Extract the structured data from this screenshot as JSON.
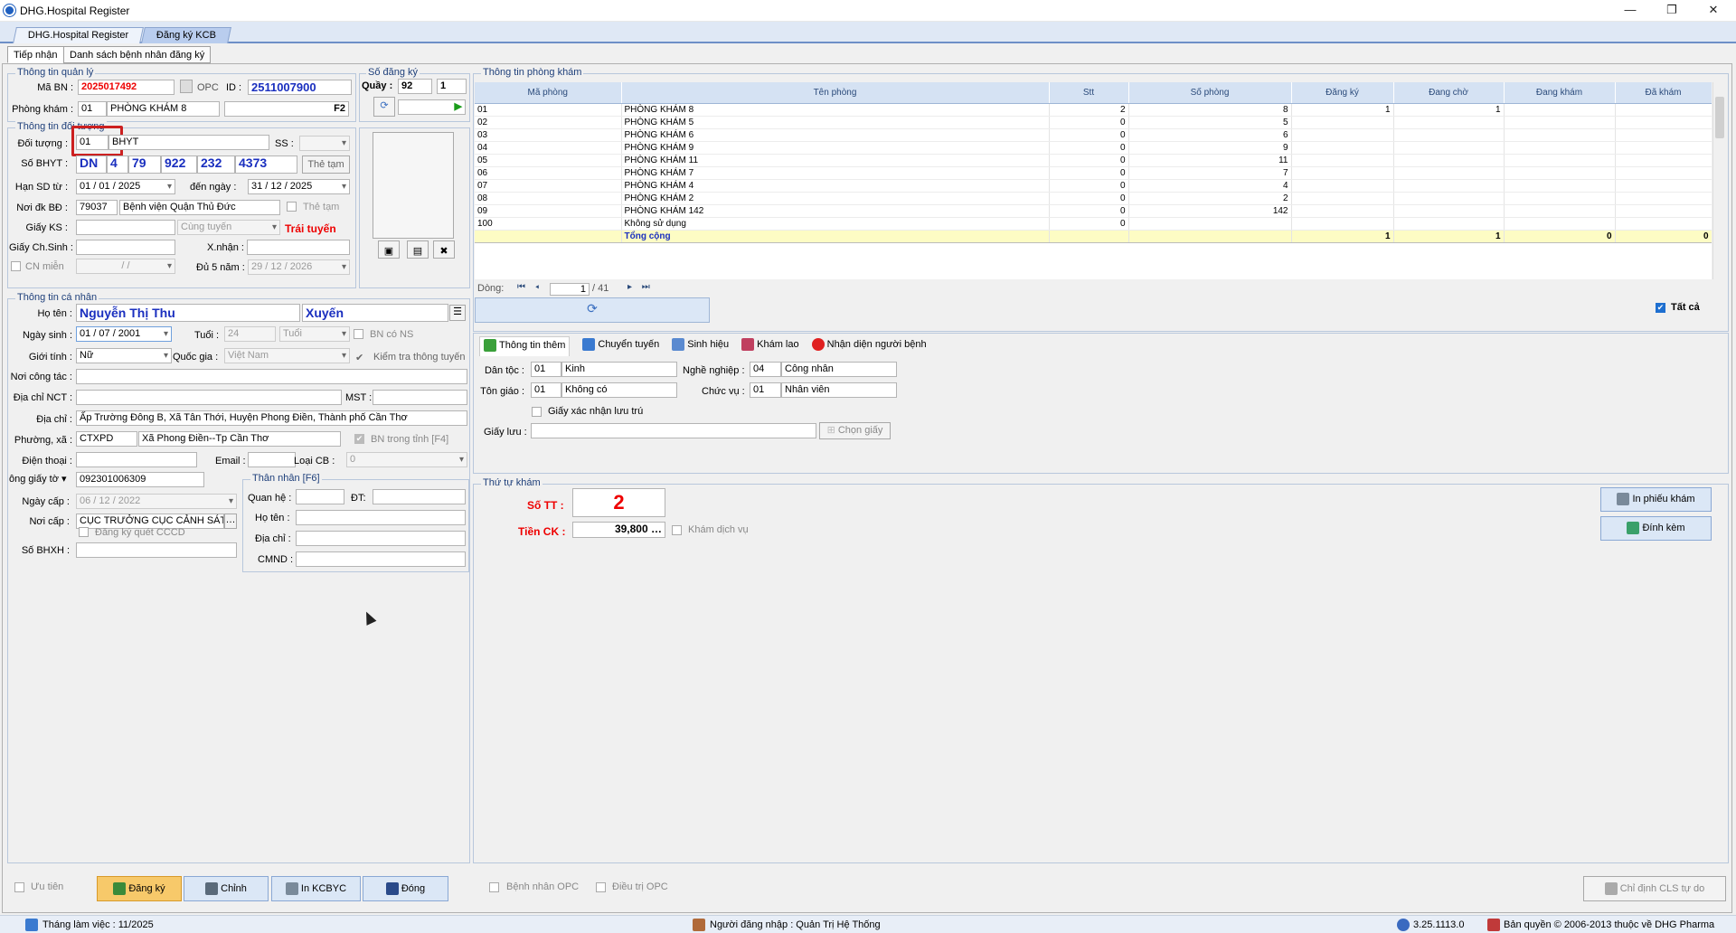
{
  "window": {
    "title": "DHG.Hospital Register",
    "minimize": "—",
    "maximize": "❐",
    "close": "✕"
  },
  "tabs": [
    "DHG.Hospital Register",
    "Đăng ký KCB"
  ],
  "subtabs": [
    "Tiếp nhận",
    "Danh sách bệnh nhân đăng ký"
  ],
  "quanly": {
    "group": "Thông tin quản lý",
    "ma_bn_label": "Mã BN :",
    "ma_bn": "2025017492",
    "opc": "OPC",
    "id_label": "ID :",
    "id": "2511007900",
    "phong_kham_label": "Phòng khám :",
    "pk_code": "01",
    "pk_name": "PHÒNG KHÁM 8",
    "f2": "F2"
  },
  "sodangky": {
    "group": "Số đăng ký",
    "quay_label": "Quầy :",
    "quay": "92",
    "num": "1"
  },
  "doituong": {
    "group": "Thông tin đối tượng",
    "doi_tuong_label": "Đối tượng :",
    "dt_code": "01",
    "dt_name": "BHYT",
    "ss_label": "SS :",
    "so_bhyt_label": "Số BHYT :",
    "bhyt": [
      "DN",
      "4",
      "79",
      "922",
      "232",
      "4373"
    ],
    "the_tam_btn": "Thẻ tạm",
    "han_sd_label": "Hạn SD từ :",
    "tu_ngay": "01 / 01 / 2025",
    "den_ngay_label": "đến ngày :",
    "den_ngay": "31 / 12 / 2025",
    "noi_dk_label": "Nơi đk BĐ :",
    "noi_dk_code": "79037",
    "noi_dk_name": "Bệnh viện Quận Thủ Đức",
    "the_tam_chk": "Thẻ tạm",
    "giay_ks_label": "Giấy KS :",
    "tuyen": "Cùng tuyến",
    "trai_tuyen": "Trái tuyến",
    "giay_chsinh_label": "Giấy Ch.Sinh :",
    "xnhan_label": "X.nhận :",
    "cn_mien_label": "CN miễn",
    "cn_mien_date": "/   /",
    "du5nam_label": "Đủ 5 năm :",
    "du5nam": "29 / 12 / 2026"
  },
  "canhan": {
    "group": "Thông tin cá nhân",
    "ho_ten_label": "Họ tên :",
    "ho_ten": "Nguyễn Thị Thu",
    "ten": "Xuyến",
    "ngay_sinh_label": "Ngày sinh :",
    "ngay_sinh": "01 / 07 / 2001",
    "tuoi_label": "Tuổi :",
    "tuoi": "24",
    "tuoi_unit": "Tuổi",
    "bn_co_ns": "BN có NS",
    "gioi_tinh_label": "Giới tính :",
    "gioi_tinh": "Nữ",
    "quoc_gia_label": "Quốc gia :",
    "quoc_gia": "Việt Nam",
    "kiem_tra": "Kiểm tra thông tuyến",
    "noi_cong_tac_label": "Nơi công tác :",
    "dia_chi_nct_label": "Địa chỉ NCT :",
    "mst_label": "MST :",
    "dia_chi_label": "Địa chỉ :",
    "dia_chi": "Ấp Trường Đông B, Xã Tân Thới, Huyện Phong Điền, Thành phố Cần Thơ",
    "phuong_xa_label": "Phường, xã :",
    "px_code": "CTXPD",
    "px_name": "Xã Phong Điền--Tp Cần Thơ",
    "bn_trong_tinh": "BN trong tỉnh [F4]",
    "dien_thoai_label": "Điện thoại :",
    "email_label": "Email :",
    "loai_cb_label": "Loại CB :",
    "loai_cb": "0",
    "giay_to_label": "ông giấy tờ",
    "giay_to": "092301006309",
    "ngay_cap_label": "Ngày cấp :",
    "ngay_cap": "06 / 12 / 2022",
    "noi_cap_label": "Nơi cấp :",
    "noi_cap": "CỤC TRƯỞNG CỤC CẢNH SÁT",
    "dk_cccd": "Đăng ký quét CCCD",
    "so_bhxh_label": "Số BHXH :"
  },
  "thannhan": {
    "group": "Thân nhân [F6]",
    "quan_he": "Quan hệ :",
    "dt": "ĐT:",
    "ho_ten": "Họ tên :",
    "dia_chi": "Địa chỉ :",
    "cmnd": "CMND :"
  },
  "phongkham": {
    "group": "Thông tin phòng khám",
    "columns": [
      "Mã phòng",
      "Tên phòng",
      "Stt",
      "Số phòng",
      "Đăng ký",
      "Đang chờ",
      "Đang khám",
      "Đã khám"
    ],
    "rows": [
      [
        "01",
        "PHÒNG KHÁM 8",
        "2",
        "8",
        "1",
        "1",
        "",
        ""
      ],
      [
        "02",
        "PHÒNG KHÁM 5",
        "0",
        "5",
        "",
        "",
        "",
        ""
      ],
      [
        "03",
        "PHÒNG KHÁM 6",
        "0",
        "6",
        "",
        "",
        "",
        ""
      ],
      [
        "04",
        "PHÒNG KHÁM 9",
        "0",
        "9",
        "",
        "",
        "",
        ""
      ],
      [
        "05",
        "PHÒNG KHÁM 11",
        "0",
        "11",
        "",
        "",
        "",
        ""
      ],
      [
        "06",
        "PHÒNG KHÁM 7",
        "0",
        "7",
        "",
        "",
        "",
        ""
      ],
      [
        "07",
        "PHÒNG KHÁM 4",
        "0",
        "4",
        "",
        "",
        "",
        ""
      ],
      [
        "08",
        "PHÒNG KHÁM 2",
        "0",
        "2",
        "",
        "",
        "",
        ""
      ],
      [
        "09",
        "PHÒNG KHÁM 142",
        "0",
        "142",
        "",
        "",
        "",
        ""
      ],
      [
        "100",
        "Không sử dụng",
        "0",
        "",
        "",
        "",
        "",
        ""
      ]
    ],
    "total": [
      "",
      "Tổng cộng",
      "",
      "",
      "1",
      "1",
      "0",
      "0"
    ],
    "dong_label": "Dòng:",
    "page": "1",
    "page_total": "/ 41",
    "tat_ca": "Tất cả"
  },
  "info_tabs": [
    "Thông tin thêm",
    "Chuyển tuyến",
    "Sinh hiệu",
    "Khám lao",
    "Nhận diện người bệnh"
  ],
  "thongtin": {
    "dan_toc_label": "Dân tộc :",
    "dt_code": "01",
    "dt_name": "Kinh",
    "nghe_label": "Nghề nghiệp :",
    "nn_code": "04",
    "nn_name": "Công nhân",
    "ton_giao_label": "Tôn giáo :",
    "tg_code": "01",
    "tg_name": "Không có",
    "chuc_vu_label": "Chức vụ :",
    "cv_code": "01",
    "cv_name": "Nhân viên",
    "giay_xn": "Giấy xác nhận lưu trú",
    "giay_luu_label": "Giấy lưu :",
    "chon_giay": "Chọn giấy"
  },
  "thutu": {
    "group": "Thứ tự khám",
    "so_tt_label": "Số TT :",
    "so_tt": "2",
    "tien_ck_label": "Tiền CK :",
    "tien_ck": "39,800",
    "kham_dv": "Khám dịch vụ",
    "in_phieu": "In phiếu khám",
    "dinh_kem": "Đính kèm"
  },
  "bottom": {
    "uu_tien": "Ưu tiên",
    "dang_ky": "Đăng ký",
    "chinh": "Chỉnh",
    "in_kcbyc": "In KCBYC",
    "dong": "Đóng",
    "bn_opc": "Bệnh nhân OPC",
    "dieu_tri_opc": "Điều trị OPC",
    "chi_dinh": "Chỉ định CLS tự do"
  },
  "status": {
    "thang": "Tháng làm việc : 11/2025",
    "nguoi": "Người đăng nhập : Quản Trị Hệ Thống",
    "ver": "3.25.1113.0",
    "copy": "Bản quyền © 2006-2013 thuộc về DHG Pharma"
  }
}
